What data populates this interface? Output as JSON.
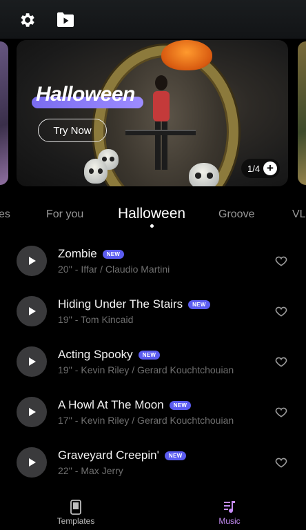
{
  "header": {
    "settings_icon": "gear-icon",
    "folder_icon": "play-folder-icon"
  },
  "hero": {
    "title": "Halloween",
    "button_label": "Try Now",
    "counter": "1/4",
    "accent_color": "#8a7cf8"
  },
  "tabs": [
    {
      "label": "es"
    },
    {
      "label": "For you"
    },
    {
      "label": "Halloween",
      "active": true
    },
    {
      "label": "Groove"
    },
    {
      "label": "VL"
    }
  ],
  "songs": [
    {
      "title": "Zombie",
      "badge": "NEW",
      "subtitle": "20'' - Iffar / Claudio Martini"
    },
    {
      "title": "Hiding Under The Stairs",
      "badge": "NEW",
      "subtitle": "19'' - Tom Kincaid"
    },
    {
      "title": "Acting Spooky",
      "badge": "NEW",
      "subtitle": "19'' - Kevin Riley / Gerard Kouchtchouian"
    },
    {
      "title": "A Howl At The Moon",
      "badge": "NEW",
      "subtitle": "17'' - Kevin Riley / Gerard Kouchtchouian"
    },
    {
      "title": "Graveyard Creepin'",
      "badge": "NEW",
      "subtitle": "22'' - Max Jerry"
    }
  ],
  "bottom_nav": [
    {
      "label": "Templates",
      "icon": "phone-icon",
      "active": false
    },
    {
      "label": "Music",
      "icon": "music-note-icon",
      "active": true,
      "color": "#c58cf5"
    }
  ]
}
